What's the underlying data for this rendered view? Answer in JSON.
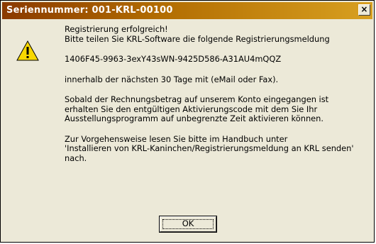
{
  "window": {
    "title": "Seriennummer: 001-KRL-00100",
    "close_label": "×"
  },
  "icon": "warning-icon",
  "message": {
    "line1": "Registrierung erfolgreich!",
    "line2": "Bitte teilen Sie KRL-Software die folgende Registrierungsmeldung",
    "code": "1406F45-9963-3exY43sWN-9425D586-A31AU4mQQZ",
    "deadline": "innerhalb der nächsten 30 Tage mit (eMail oder Fax).",
    "para3": [
      "Sobald der Rechnungsbetrag auf unserem Konto eingegangen ist",
      "erhalten Sie den entgültigen Aktivierungscode mit dem Sie Ihr",
      "Ausstellungsprogramm auf unbegrenzte Zeit aktivieren können."
    ],
    "para4": [
      "Zur Vorgehensweise lesen Sie bitte im Handbuch unter",
      "'Installieren von KRL-Kaninchen/Registrierungsmeldung an KRL senden'",
      "nach."
    ]
  },
  "buttons": {
    "ok_label": "OK"
  },
  "colors": {
    "title_gradient_start": "#8a3a00",
    "title_gradient_end": "#d8a020",
    "dialog_bg": "#ece9d8",
    "warning_yellow": "#f8d800"
  }
}
